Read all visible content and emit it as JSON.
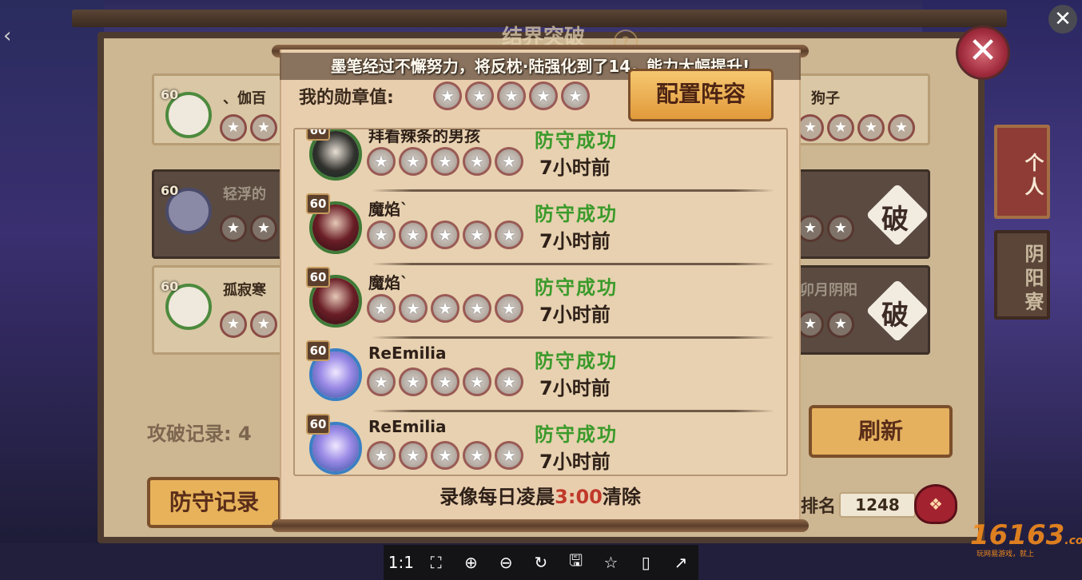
{
  "game": {
    "title": "结界突破",
    "help_glyph": "?",
    "close_glyph": "✕",
    "attack_record_label": "攻破记录:",
    "attack_record_count": "4",
    "defense_record_button": "防守记录",
    "refresh_button": "刷新",
    "rank_label": "排名",
    "rank_value": "1248",
    "side_tabs": [
      "个人",
      "阴阳寮"
    ],
    "bg_cards": [
      {
        "level": "60",
        "name": "、伽百",
        "dark": false
      },
      {
        "level": "60",
        "name": "轻浮的",
        "dark": true
      },
      {
        "level": "60",
        "name": "孤寂寒",
        "dark": false
      },
      {
        "level": "",
        "name": "狗子",
        "dark": false
      },
      {
        "level": "",
        "name": "",
        "dark": true,
        "break": "破"
      },
      {
        "level": "",
        "name": "卯月阴阳",
        "dark": true,
        "break": "破"
      }
    ]
  },
  "popup": {
    "notice": "墨笔经过不懈努力，将反枕·陆强化到了14，能力大幅提升!",
    "my_medals_label": "我的勋章值:",
    "medal_glyph": "★",
    "config_button": "配置阵容",
    "records": [
      {
        "level": "60",
        "name": "拜看辣条的男孩",
        "status": "防守成功",
        "time": "7小时前",
        "avatar": "dark"
      },
      {
        "level": "60",
        "name": "魔焰`",
        "status": "防守成功",
        "time": "7小时前",
        "avatar": "red"
      },
      {
        "level": "60",
        "name": "魔焰`",
        "status": "防守成功",
        "time": "7小时前",
        "avatar": "red"
      },
      {
        "level": "60",
        "name": "ReEmilia",
        "status": "防守成功",
        "time": "7小时前",
        "avatar": "blue"
      },
      {
        "level": "60",
        "name": "ReEmilia",
        "status": "防守成功",
        "time": "7小时前",
        "avatar": "blue"
      }
    ],
    "footer_prefix": "录像每日凌晨",
    "footer_time": "3:00",
    "footer_suffix": "清除"
  },
  "viewer": {
    "close_glyph": "✕",
    "nav_prev": "‹",
    "toolbar": [
      {
        "name": "actual-size",
        "glyph": "1:1"
      },
      {
        "name": "fit-screen",
        "glyph": "⛶"
      },
      {
        "name": "zoom-in",
        "glyph": "⊕"
      },
      {
        "name": "zoom-out",
        "glyph": "⊖"
      },
      {
        "name": "rotate",
        "glyph": "↻"
      },
      {
        "name": "save",
        "glyph": "🖫"
      },
      {
        "name": "favorite",
        "glyph": "☆"
      },
      {
        "name": "mobile",
        "glyph": "▯"
      },
      {
        "name": "share",
        "glyph": "↗"
      }
    ],
    "watermark": "16163",
    "watermark_domain": ".com",
    "watermark_sub": "玩网易游戏，就上"
  },
  "colors": {
    "status_success": "#3a9a2a",
    "footer_highlight": "#c0392b",
    "button_gold": "#e5b15e"
  }
}
